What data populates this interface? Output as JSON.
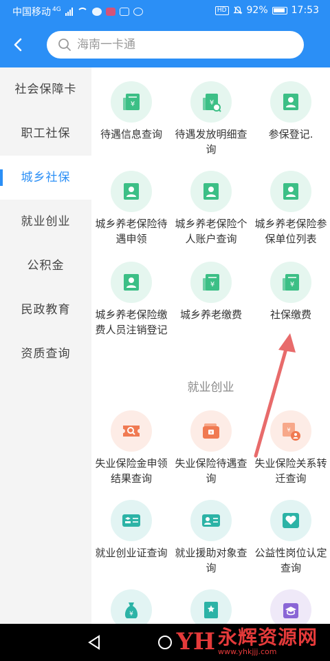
{
  "status_bar": {
    "carrier": "中国移动",
    "network": "4G",
    "battery": "92%",
    "time": "17:53"
  },
  "search": {
    "placeholder": "海南一卡通"
  },
  "sidebar": {
    "items": [
      {
        "label": "社会保障卡"
      },
      {
        "label": "职工社保"
      },
      {
        "label": "城乡社保"
      },
      {
        "label": "就业创业"
      },
      {
        "label": "公积金"
      },
      {
        "label": "民政教育"
      },
      {
        "label": "资质查询"
      }
    ],
    "active_index": 2
  },
  "section_title": "就业创业",
  "grid": {
    "items": [
      {
        "label": "待遇信息查询",
        "icon": "receipt-yen-icon"
      },
      {
        "label": "待遇发放明细查询",
        "icon": "receipt-search-icon"
      },
      {
        "label": "参保登记.",
        "icon": "person-card-icon"
      },
      {
        "label": "城乡养老保险待遇申领",
        "icon": "person-card-icon"
      },
      {
        "label": "城乡养老保险个人账户查询",
        "icon": "person-card-icon"
      },
      {
        "label": "城乡养老保险参保单位列表",
        "icon": "person-card-icon"
      },
      {
        "label": "城乡养老保险缴费人员注销登记",
        "icon": "person-card-icon"
      },
      {
        "label": "城乡养老缴费",
        "icon": "receipt-yen-icon"
      },
      {
        "label": "社保缴费",
        "icon": "receipt-yen-icon"
      },
      {
        "label": "失业保险金申领结果查询",
        "icon": "ticket-search-icon"
      },
      {
        "label": "失业保险待遇查询",
        "icon": "wallet-icon"
      },
      {
        "label": "失业保险关系转迁查询",
        "icon": "transfer-person-icon"
      },
      {
        "label": "就业创业证查询",
        "icon": "certificate-icon"
      },
      {
        "label": "就业援助对象查询",
        "icon": "id-card-icon"
      },
      {
        "label": "公益性岗位认定查询",
        "icon": "heart-hand-icon"
      },
      {
        "label": "",
        "icon": "money-bag-icon"
      },
      {
        "label": "",
        "icon": "bookmark-icon"
      },
      {
        "label": "",
        "icon": "graduation-icon"
      }
    ]
  },
  "watermark": {
    "logo": "YH",
    "title": "永辉资源网",
    "url": "www.yhkjjj.com"
  },
  "colors": {
    "primary": "#2b8ff6",
    "green_icon": "#3cbf86",
    "orange_icon": "#f07a52",
    "teal_icon": "#2cb3a6",
    "purple_icon": "#8a66d6"
  }
}
